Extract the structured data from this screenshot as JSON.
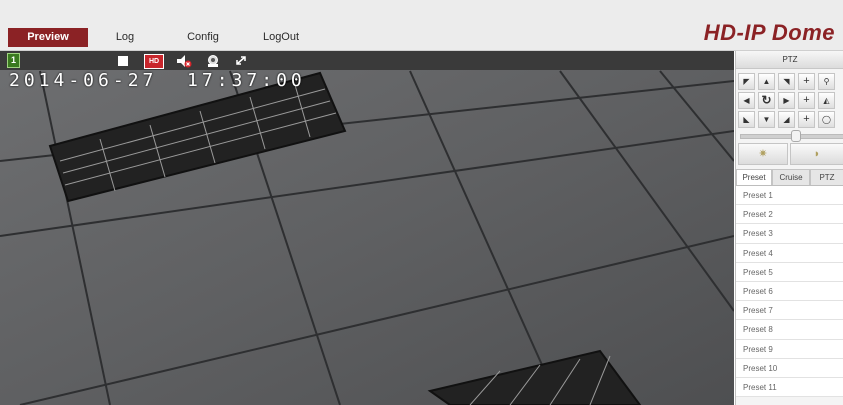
{
  "nav": {
    "tabs": [
      {
        "label": "Preview",
        "active": true
      },
      {
        "label": "Log",
        "active": false
      },
      {
        "label": "Config",
        "active": false
      },
      {
        "label": "LogOut",
        "active": false
      }
    ],
    "brand": "HD-IP Dome"
  },
  "video": {
    "channel_badge": "1",
    "hd_badge": "HD",
    "osd_timestamp": "2014-06-27  17:37:00",
    "toolbar_icons": [
      "stop-icon",
      "hd-icon",
      "mute-speaker-icon",
      "snapshot-icon",
      "fullscreen-icon"
    ]
  },
  "ptz": {
    "title": "PTZ",
    "grid": [
      [
        "arrow-up-left",
        "arrow-up",
        "arrow-up-right",
        "plus",
        "zoom-in"
      ],
      [
        "arrow-left",
        "auto-rotate",
        "arrow-right",
        "plus",
        "focus"
      ],
      [
        "arrow-down-left",
        "arrow-down",
        "arrow-down-right",
        "plus",
        "iris"
      ]
    ],
    "plus_label": "+",
    "speed_level": 0.55,
    "extra_icons": [
      "light-icon",
      "wiper-icon"
    ]
  },
  "subtabs": [
    {
      "label": "Preset",
      "active": true
    },
    {
      "label": "Cruise",
      "active": false
    },
    {
      "label": "PTZ",
      "active": false
    }
  ],
  "presets": [
    "Preset  1",
    "Preset  2",
    "Preset  3",
    "Preset  4",
    "Preset  5",
    "Preset  6",
    "Preset  7",
    "Preset  8",
    "Preset  9",
    "Preset  10",
    "Preset  11"
  ],
  "colors": {
    "accent": "#8b2225",
    "toolbar": "#3a3a3a",
    "channel": "#3a7a1f"
  }
}
